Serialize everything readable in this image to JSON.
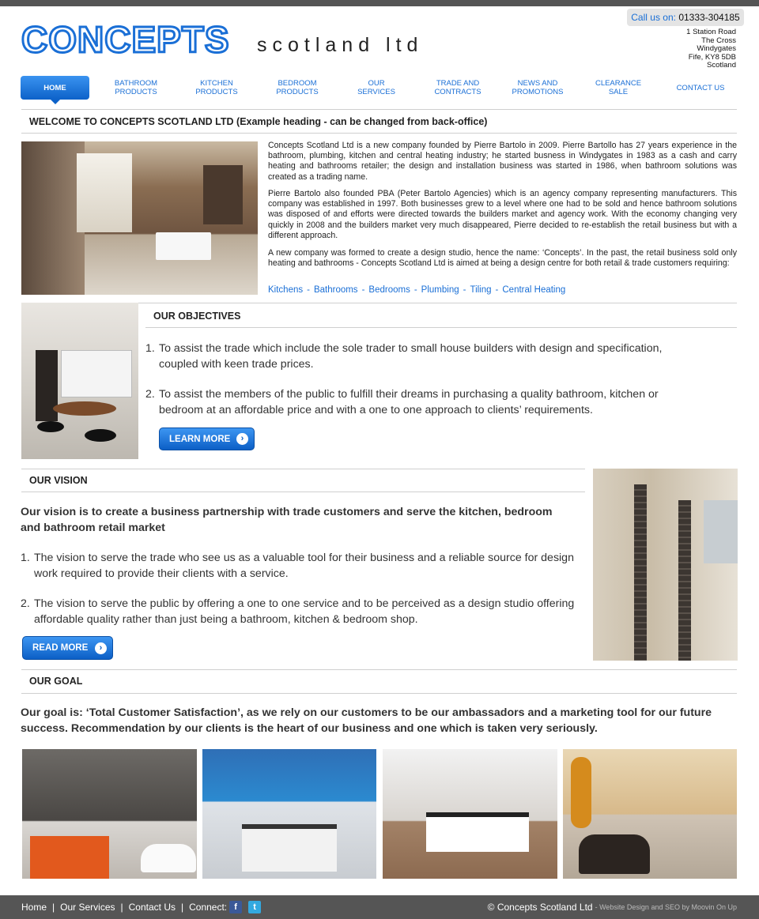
{
  "header": {
    "logo_main": "CONCEPTS",
    "logo_sub": "scotland ltd",
    "callus_label": "Call us on:",
    "callus_number": "01333-304185",
    "address": [
      "1 Station Road",
      "The Cross",
      "Windygates",
      "Fife, KY8 5DB",
      "Scotland"
    ]
  },
  "nav": {
    "items": [
      {
        "label": "HOME",
        "active": true
      },
      {
        "label": "BATHROOM PRODUCTS"
      },
      {
        "label": "KITCHEN PRODUCTS"
      },
      {
        "label": "BEDROOM PRODUCTS"
      },
      {
        "label": "OUR SERVICES"
      },
      {
        "label": "TRADE AND CONTRACTS"
      },
      {
        "label": "NEWS AND PROMOTIONS"
      },
      {
        "label": "CLEARANCE SALE"
      },
      {
        "label": "CONTACT US"
      }
    ]
  },
  "welcome": {
    "heading": "WELCOME TO CONCEPTS SCOTLAND LTD (Example heading - can be changed from back-office)",
    "paragraphs": [
      "Concepts Scotland Ltd is a new company founded by Pierre Bartolo in 2009.  Pierre Bartollo has 27 years experience in the bathroom, plumbing, kitchen and central heating industry; he started busness in Windygates in 1983 as a cash and carry heating and bathrooms retailer; the design and installation business was started in 1986, when bathroom solutions was created as a trading name.",
      "Pierre Bartolo also founded PBA (Peter Bartolo Agencies) which is an agency company representing manufacturers.  This company was established in 1997.  Both businesses grew to a level where one had to be sold and hence bathroom solutions was disposed of and efforts were directed towards the builders market and agency work.  With the economy changing very quickly in 2008 and the builders market very much disappeared, Pierre decided to re-establish the retail business but with a different approach.",
      "A new company was formed to create a design studio, hence the name: ‘Concepts’.  In the past, the retail business sold only heating and bathrooms - Concepts Scotland Ltd is aimed at being a design centre for both retail & trade customers requiring:"
    ],
    "links": [
      "Kitchens",
      "Bathrooms",
      "Bedrooms",
      "Plumbing",
      "Tiling",
      "Central Heating"
    ]
  },
  "objectives": {
    "heading": "OUR OBJECTIVES",
    "items": [
      {
        "num": "1.",
        "text": "To assist the trade which include the sole trader to small house builders with design and specification, coupled with keen trade prices."
      },
      {
        "num": "2.",
        "text": "To assist the members of the public to fulfill their dreams in purchasing a quality bathroom, kitchen or bedroom at an affordable price and with a one to one approach to clients’ requirements."
      }
    ],
    "button": "LEARN MORE"
  },
  "vision": {
    "heading": "OUR VISION",
    "lead": "Our vision is to create a business partnership with trade customers and serve the kitchen, bedroom and bathroom retail market",
    "items": [
      {
        "num": "1.",
        "text": "The vision to serve the trade who see us as a valuable tool for their business and a reliable source for design work required to provide their clients with a service."
      },
      {
        "num": "2.",
        "text": "The vision to serve the public by offering a one to one service and to be perceived as a design studio offering affordable quality rather than just being a bathroom, kitchen & bedroom shop."
      }
    ],
    "button": "READ MORE"
  },
  "goal": {
    "heading": "OUR GOAL",
    "lead": "Our goal is: ‘Total Customer Satisfaction’, as we rely on our customers to be our ambassadors and a marketing tool for our future success.  Recommendation by our clients is the heart of our business and one which is taken very seriously."
  },
  "footer": {
    "links": [
      "Home",
      "Our Services",
      "Contact Us"
    ],
    "connect_label": "Connect:",
    "social": [
      "facebook-icon",
      "twitter-icon"
    ],
    "copyright": "© Concepts Scotland Ltd",
    "credit": "- Website Design and SEO by Moovin On Up"
  },
  "colors": {
    "accent": "#1a6fd6",
    "footer_bg": "#555555",
    "topbar": "#555555"
  }
}
